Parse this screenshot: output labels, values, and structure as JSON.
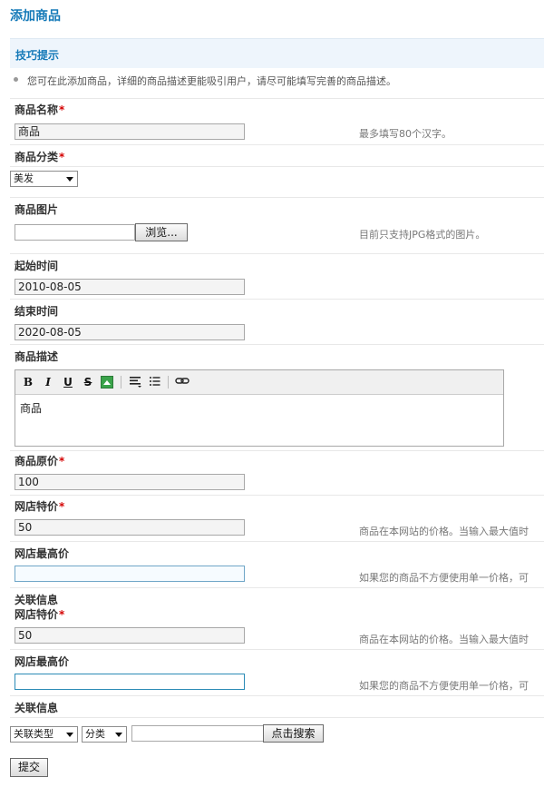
{
  "page": {
    "title": "添加商品"
  },
  "tips": {
    "title": "技巧提示",
    "text": "您可在此添加商品，详细的商品描述更能吸引用户，请尽可能填写完善的商品描述。"
  },
  "form": {
    "name": {
      "label": "商品名称",
      "value": "商品",
      "hint": "最多填写80个汉字。"
    },
    "category": {
      "label": "商品分类",
      "value": "美发"
    },
    "image": {
      "label": "商品图片",
      "browse_label": "浏览...",
      "hint": "目前只支持JPG格式的图片。"
    },
    "start_time": {
      "label": "起始时间",
      "value": "2010-08-05"
    },
    "end_time": {
      "label": "结束时间",
      "value": "2020-08-05"
    },
    "description": {
      "label": "商品描述",
      "content": "商品",
      "toolbar": {
        "bold": "B",
        "italic": "I",
        "underline": "U",
        "strike": "S",
        "image": "image-icon",
        "align": "align-icon",
        "list": "list-icon",
        "link": "link-icon"
      }
    },
    "original_price": {
      "label": "商品原价",
      "value": "100"
    },
    "special_price_1": {
      "label": "网店特价",
      "value": "50",
      "hint": "商品在本网站的价格。当输入最大值时"
    },
    "max_price_1": {
      "label": "网店最高价",
      "value": "",
      "hint": "如果您的商品不方便使用单一价格，可"
    },
    "related_1": {
      "label": "关联信息"
    },
    "special_price_2": {
      "label": "网店特价",
      "value": "50",
      "hint": "商品在本网站的价格。当输入最大值时"
    },
    "max_price_2": {
      "label": "网店最高价",
      "value": "",
      "hint": "如果您的商品不方便使用单一价格，可"
    },
    "related_2": {
      "label": "关联信息"
    },
    "relation_type": {
      "value": "关联类型"
    },
    "relation_category": {
      "value": "分类"
    },
    "search": {
      "value": "",
      "button_label": "点击搜索"
    },
    "submit_label": "提交"
  },
  "colors": {
    "title": "#1479b8",
    "required": "#d40000",
    "tip_bg": "#eef5fc"
  }
}
